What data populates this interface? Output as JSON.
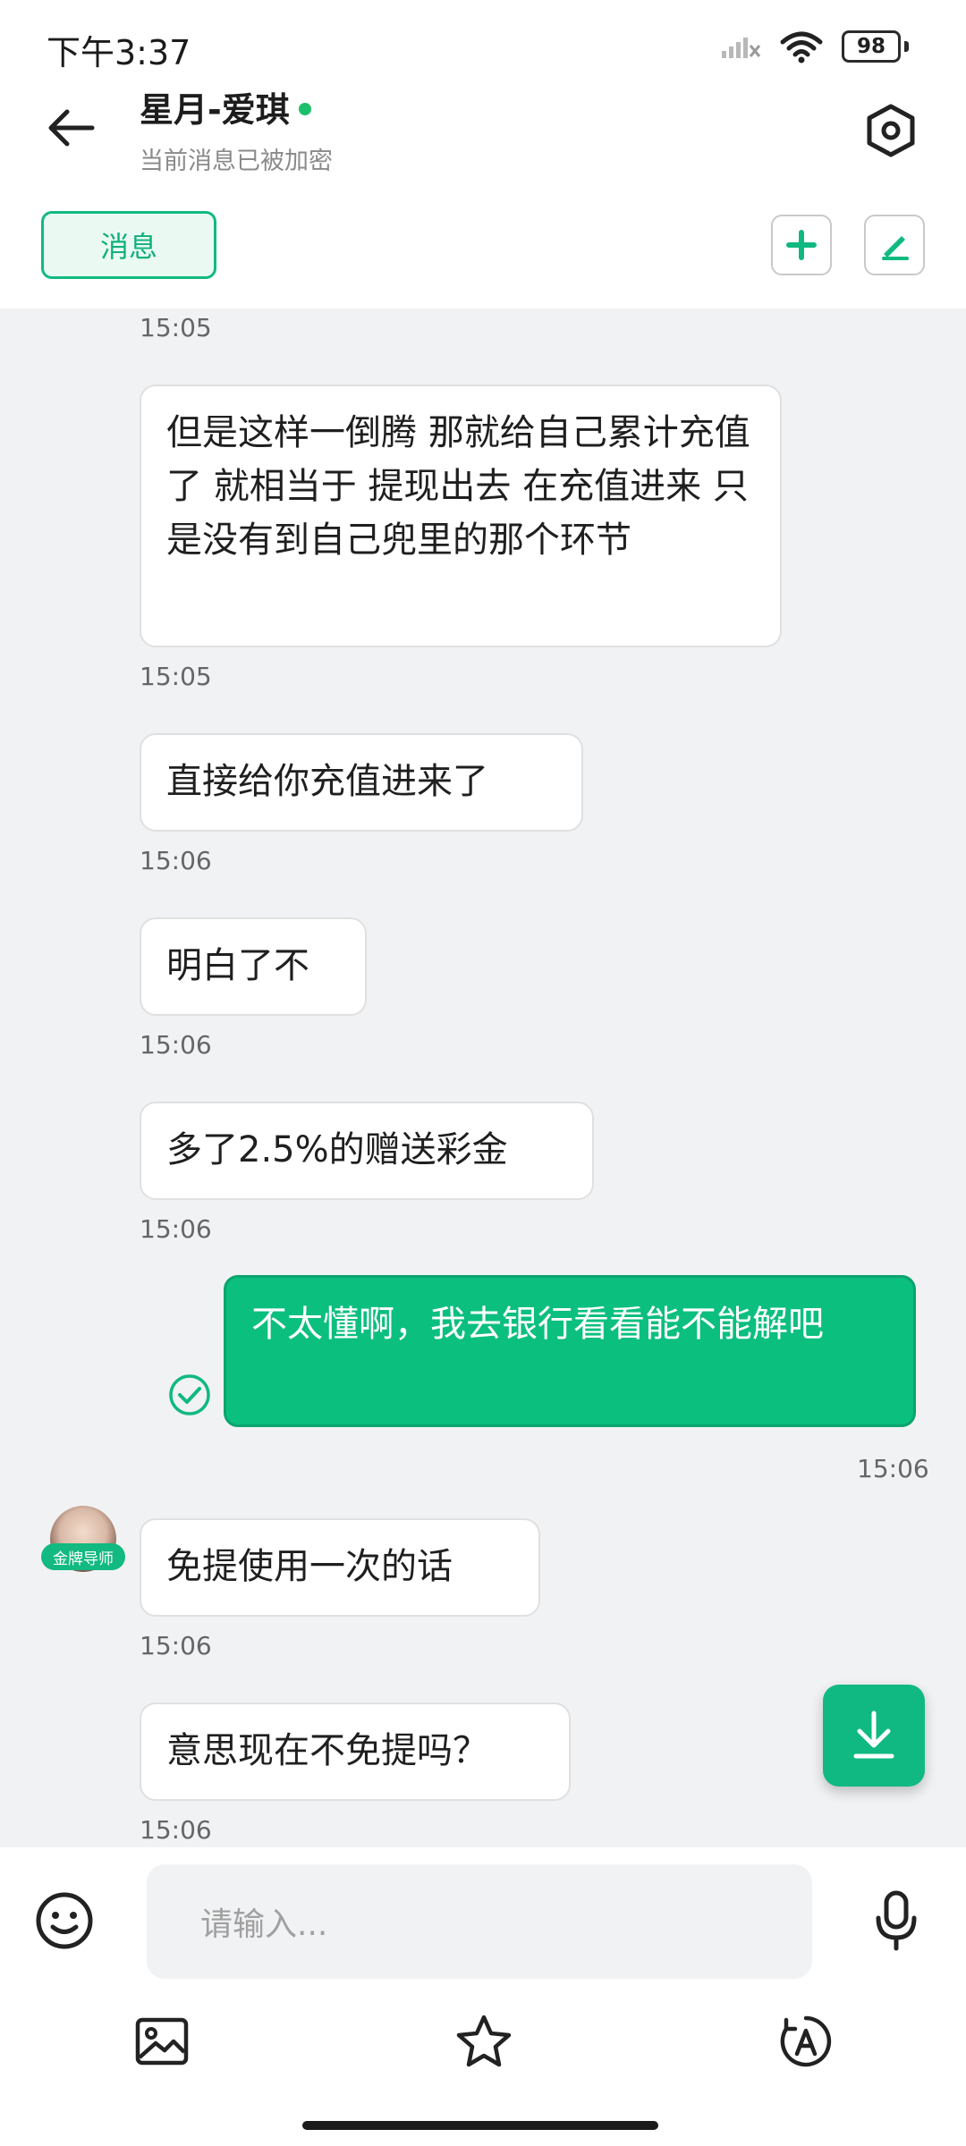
{
  "status_bar": {
    "time": "下午3:37",
    "battery": "98"
  },
  "header": {
    "title": "星月-爱琪",
    "subtitle": "当前消息已被加密"
  },
  "tabs": {
    "messages": "消息"
  },
  "chat": {
    "messages": [
      {
        "sender": "other",
        "time": "15:05",
        "text": ""
      },
      {
        "sender": "other",
        "text": "但是这样一倒腾  那就给自己累计充值了 就相当于 提现出去 在充值进来  只是没有到自己兜里的那个环节",
        "time": "15:05"
      },
      {
        "sender": "other",
        "text": "直接给你充值进来了",
        "time": "15:06"
      },
      {
        "sender": "other",
        "text": "明白了不",
        "time": "15:06"
      },
      {
        "sender": "other",
        "text": "多了2.5%的赠送彩金",
        "time": "15:06"
      },
      {
        "sender": "me",
        "text": "不太懂啊，我去银行看看能不能解吧",
        "time": "15:06"
      },
      {
        "sender": "other",
        "text": "免提使用一次的话",
        "time": "15:06",
        "avatar_tag": "金牌导师"
      },
      {
        "sender": "other",
        "text": "意思现在不免提吗？",
        "time": "15:06"
      }
    ]
  },
  "input": {
    "placeholder": "请输入..."
  },
  "colors": {
    "accent": "#10b981",
    "bubble_mine": "#0bbf7f",
    "background": "#f1f2f4"
  },
  "icons": {
    "back": "arrow-left-icon",
    "settings": "hexagon-settings-icon",
    "add": "plus-icon",
    "edit": "pen-icon",
    "download": "download-arrow-icon",
    "emoji": "smiley-icon",
    "mic": "microphone-icon",
    "image": "image-icon",
    "star": "star-icon",
    "translate": "translate-icon",
    "check": "check-circle-icon"
  }
}
